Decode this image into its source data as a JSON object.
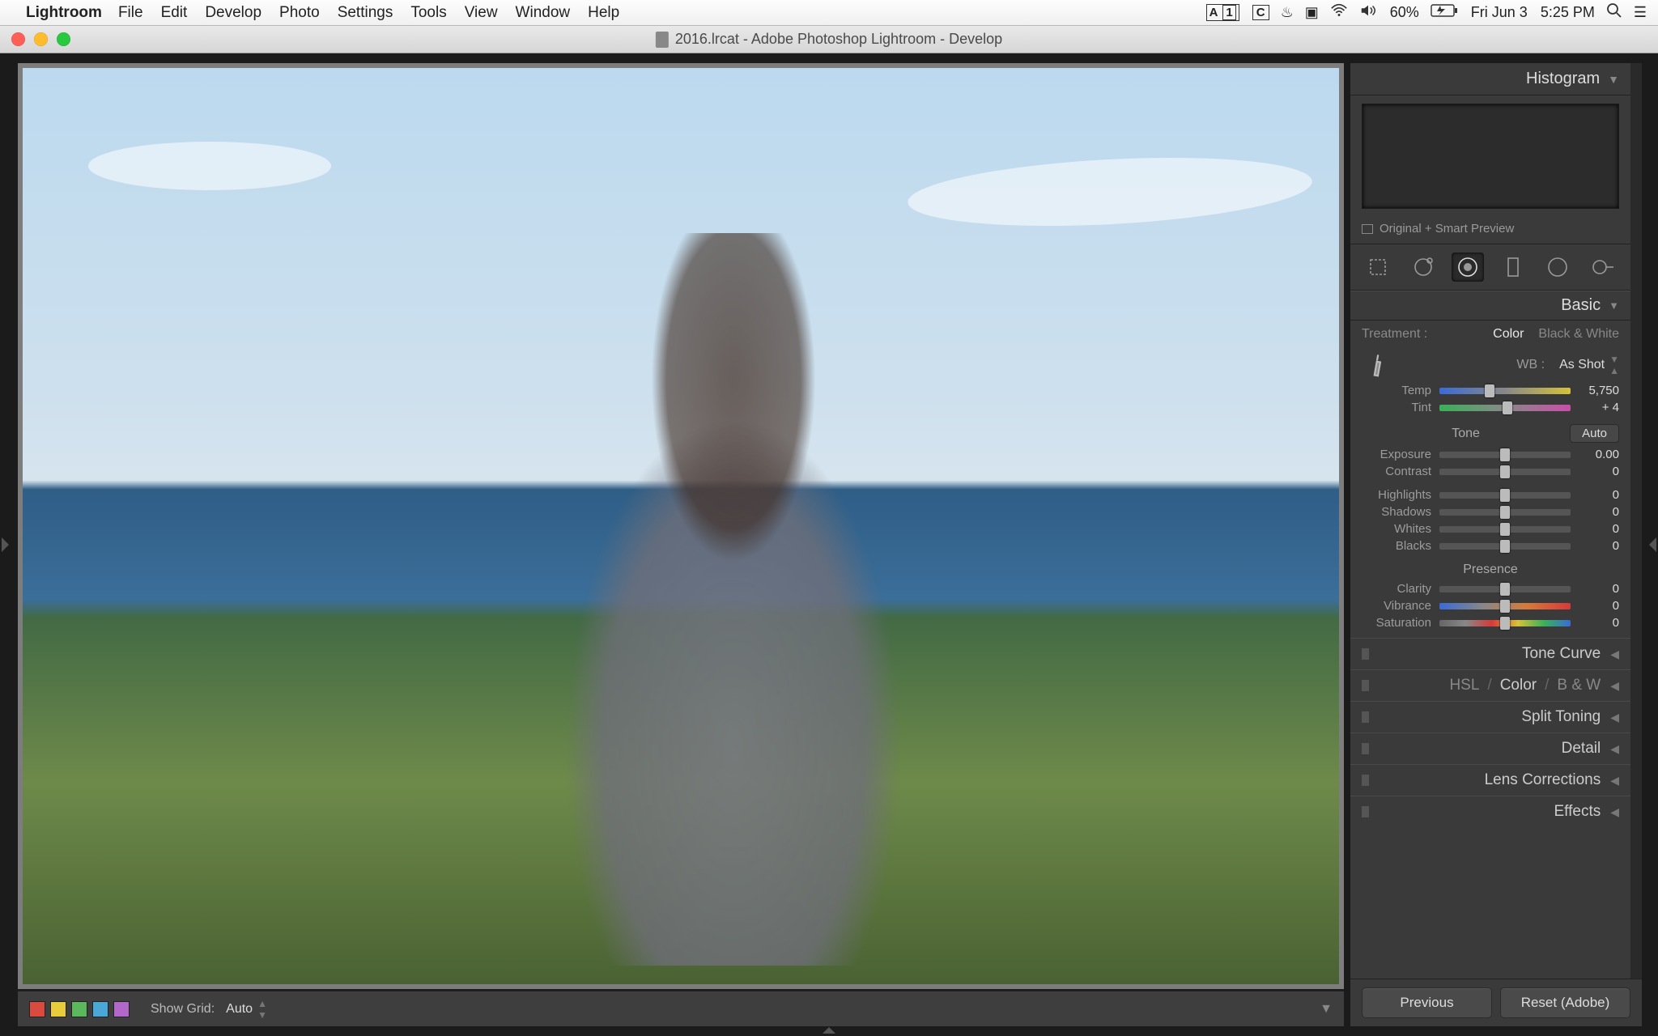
{
  "menubar": {
    "app": "Lightroom",
    "items": [
      "File",
      "Edit",
      "Develop",
      "Photo",
      "Settings",
      "Tools",
      "View",
      "Window",
      "Help"
    ],
    "right": {
      "a1": "1",
      "battery": "60%",
      "date": "Fri Jun 3",
      "time": "5:25 PM"
    }
  },
  "window": {
    "title": "2016.lrcat - Adobe Photoshop Lightroom - Develop"
  },
  "panel": {
    "histogram": {
      "title": "Histogram"
    },
    "preview": {
      "text": "Original + Smart Preview"
    },
    "basic": {
      "title": "Basic",
      "treatment_label": "Treatment :",
      "treatment": {
        "color": "Color",
        "bw": "Black & White"
      },
      "wb_label": "WB :",
      "wb_value": "As Shot",
      "temp": {
        "label": "Temp",
        "value": "5,750",
        "pos": 38
      },
      "tint": {
        "label": "Tint",
        "value": "+ 4",
        "pos": 52
      },
      "tone_label": "Tone",
      "auto": "Auto",
      "exposure": {
        "label": "Exposure",
        "value": "0.00",
        "pos": 50
      },
      "contrast": {
        "label": "Contrast",
        "value": "0",
        "pos": 50
      },
      "highlights": {
        "label": "Highlights",
        "value": "0",
        "pos": 50
      },
      "shadows": {
        "label": "Shadows",
        "value": "0",
        "pos": 50
      },
      "whites": {
        "label": "Whites",
        "value": "0",
        "pos": 50
      },
      "blacks": {
        "label": "Blacks",
        "value": "0",
        "pos": 50
      },
      "presence_label": "Presence",
      "clarity": {
        "label": "Clarity",
        "value": "0",
        "pos": 50
      },
      "vibrance": {
        "label": "Vibrance",
        "value": "0",
        "pos": 50
      },
      "saturation": {
        "label": "Saturation",
        "value": "0",
        "pos": 50
      }
    },
    "sections": {
      "tone_curve": "Tone Curve",
      "hsl": "HSL",
      "hsl_color": "Color",
      "hsl_bw": "B & W",
      "split": "Split Toning",
      "detail": "Detail",
      "lens": "Lens Corrections",
      "effects": "Effects"
    },
    "actions": {
      "previous": "Previous",
      "reset": "Reset (Adobe)"
    }
  },
  "toolbar": {
    "colors": [
      "#d94b3f",
      "#e8cc3a",
      "#5cb85c",
      "#4aa8d8",
      "#5a6fd8",
      "#b268c8"
    ],
    "grid_label": "Show Grid:",
    "grid_value": "Auto"
  }
}
